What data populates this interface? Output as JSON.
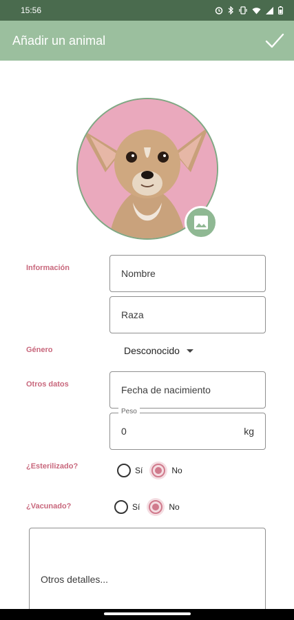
{
  "status_bar": {
    "time": "15:56",
    "icons": [
      "alarm-icon",
      "bluetooth-icon",
      "vibrate-icon",
      "wifi-icon",
      "signal-icon",
      "battery-icon"
    ]
  },
  "app_bar": {
    "title": "Añadir un animal",
    "confirm_icon": "check-icon"
  },
  "avatar": {
    "image": "chihuahua-photo",
    "edit_icon": "image-icon"
  },
  "form": {
    "info": {
      "label": "Información",
      "name_placeholder": "Nombre",
      "breed_placeholder": "Raza"
    },
    "gender": {
      "label": "Género",
      "selected": "Desconocido"
    },
    "other": {
      "label": "Otros datos",
      "birthdate_placeholder": "Fecha de nacimiento",
      "weight_label": "Peso",
      "weight_value": "0",
      "weight_unit": "kg"
    },
    "sterilized": {
      "label": "¿Esterilizado?",
      "yes": "Sí",
      "no": "No",
      "selected": "No"
    },
    "vaccinated": {
      "label": "¿Vacunado?",
      "yes": "Sí",
      "no": "No",
      "selected": "No"
    },
    "details_placeholder": "Otros detalles..."
  },
  "colors": {
    "status_bar": "#4a6b4e",
    "app_bar": "#9bbf9e",
    "accent_pink": "#c8677c",
    "radio_pink": "#d07a8c"
  }
}
